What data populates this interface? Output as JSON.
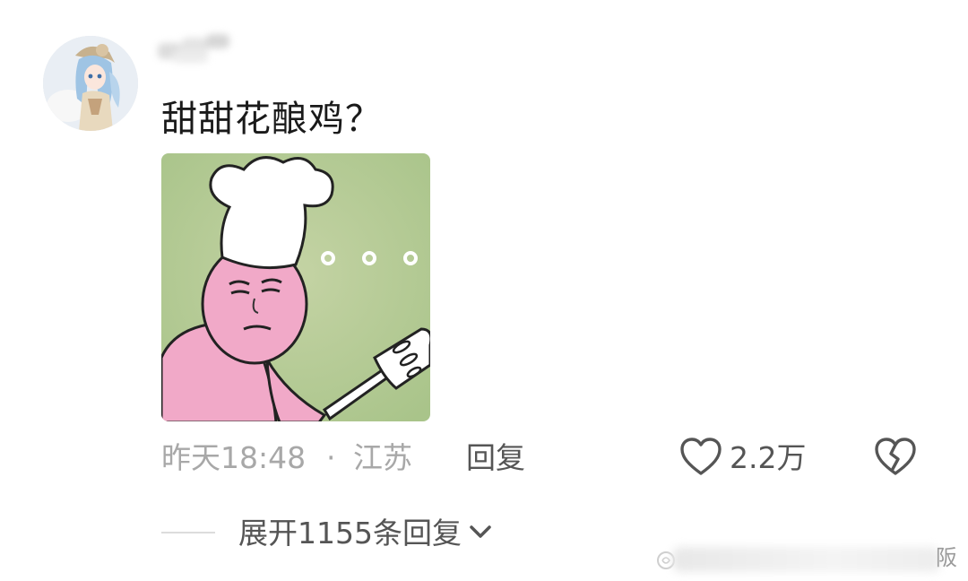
{
  "comment": {
    "text": "甜甜花酿鸡？",
    "time": "昨天18:48",
    "separator": "·",
    "location": "江苏",
    "reply_label": "回复",
    "like_count": "2.2万"
  },
  "replies": {
    "expand_label": "展开1155条回复"
  },
  "watermark": {
    "visible_char": "阪"
  },
  "icons": {
    "like": "heart-outline-icon",
    "dislike": "broken-heart-icon",
    "expand": "chevron-down-icon"
  },
  "colors": {
    "primary_text": "#1a1a1a",
    "secondary_text": "#a8a8a8",
    "action_text": "#555555",
    "sticker_background": "#b7cc95",
    "sticker_skin": "#f1a9c8"
  }
}
